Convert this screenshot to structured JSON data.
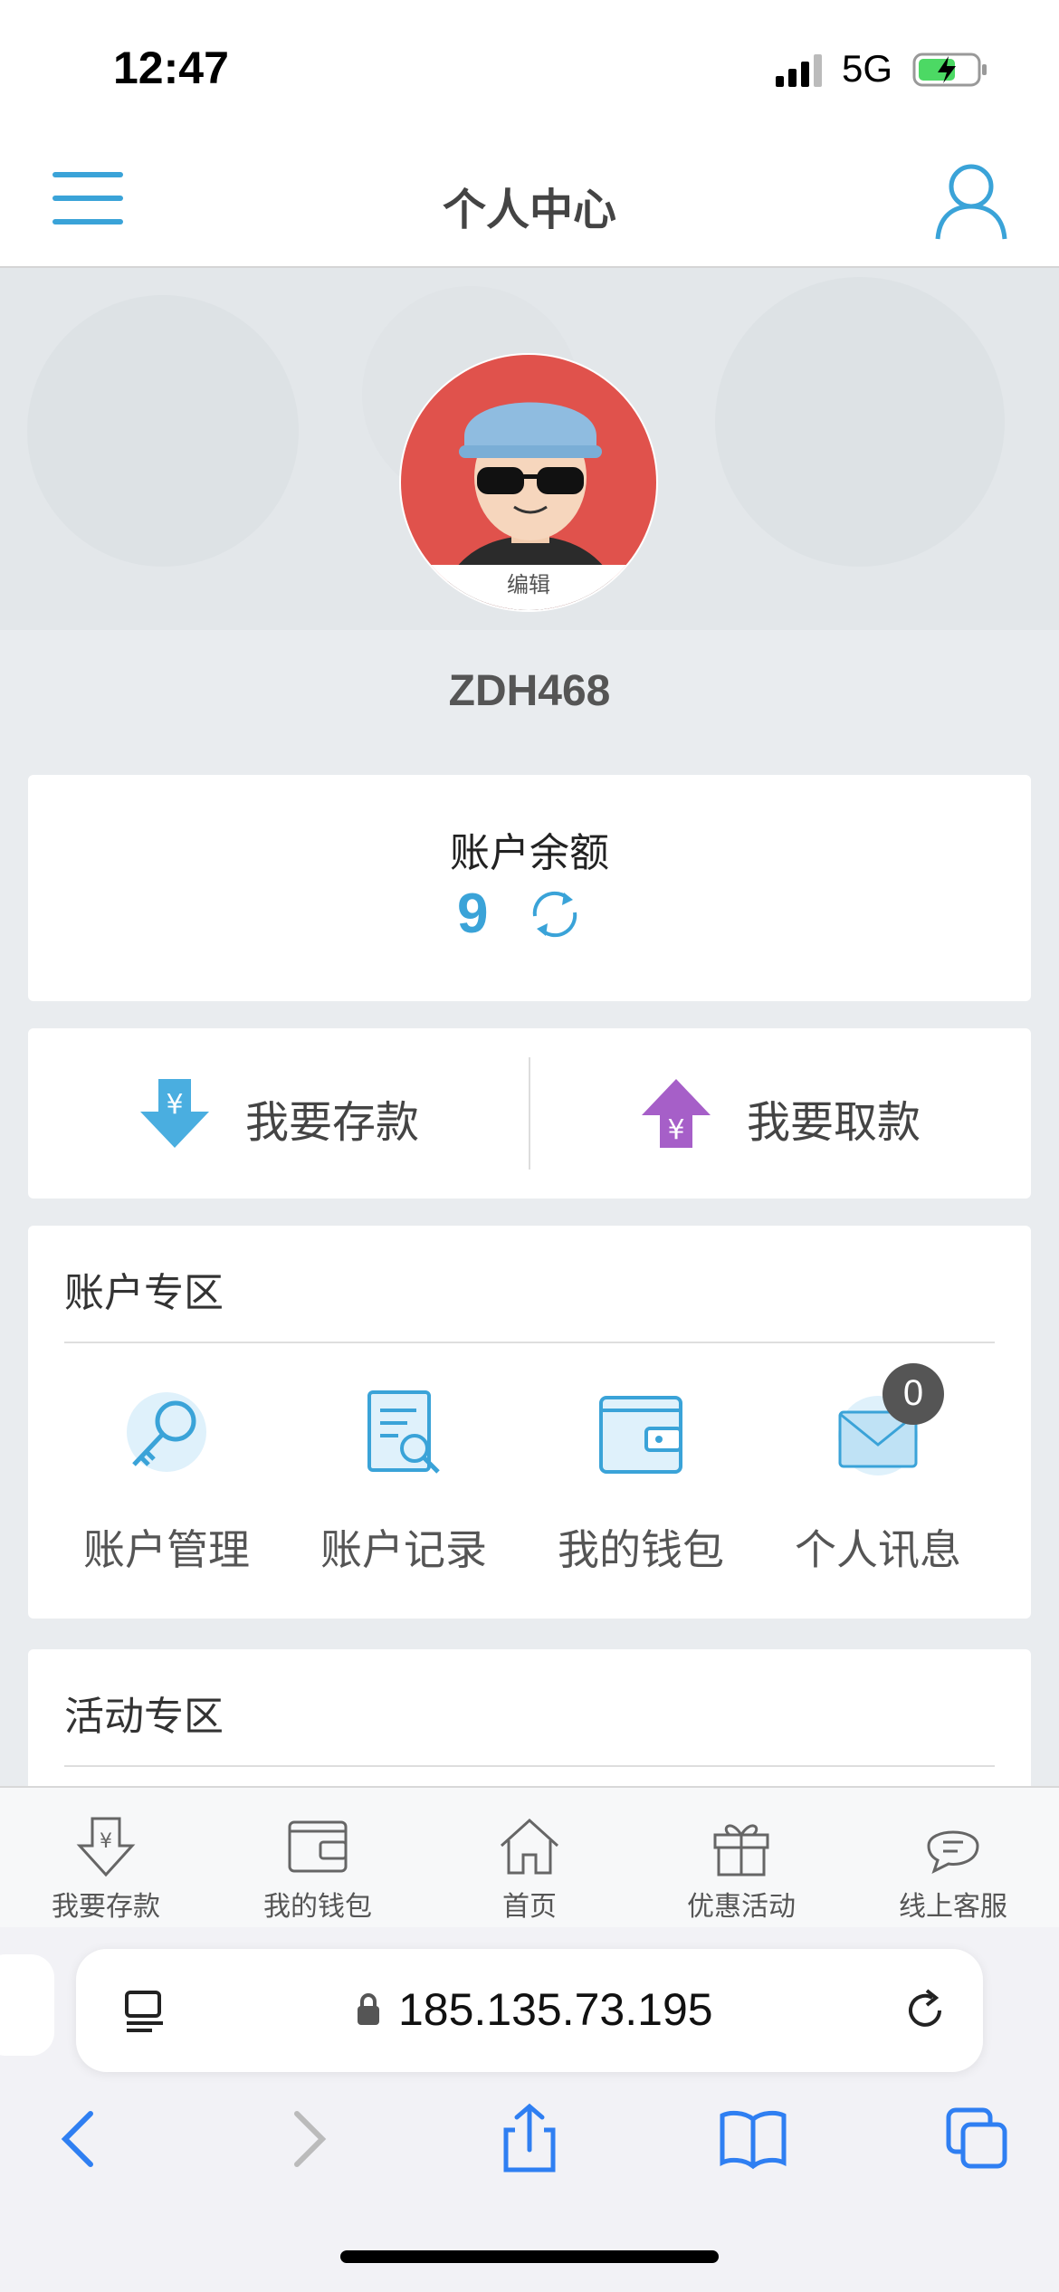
{
  "status_bar": {
    "time": "12:47",
    "network": "5G"
  },
  "header": {
    "title": "个人中心"
  },
  "profile": {
    "edit_label": "编辑",
    "username": "ZDH468"
  },
  "balance": {
    "label": "账户余额",
    "value": "9"
  },
  "actions": {
    "deposit": "我要存款",
    "withdraw": "我要取款"
  },
  "account_zone": {
    "title": "账户专区",
    "items": [
      {
        "label": "账户管理",
        "icon": "key-icon"
      },
      {
        "label": "账户记录",
        "icon": "document-search-icon"
      },
      {
        "label": "我的钱包",
        "icon": "wallet-icon"
      },
      {
        "label": "个人讯息",
        "icon": "mail-icon",
        "badge": "0"
      }
    ]
  },
  "activity_zone": {
    "title": "活动专区"
  },
  "tabbar": {
    "items": [
      {
        "label": "我要存款",
        "icon": "deposit-icon"
      },
      {
        "label": "我的钱包",
        "icon": "wallet-icon"
      },
      {
        "label": "首页",
        "icon": "home-icon"
      },
      {
        "label": "优惠活动",
        "icon": "gift-icon"
      },
      {
        "label": "线上客服",
        "icon": "chat-icon"
      }
    ]
  },
  "browser": {
    "url": "185.135.73.195"
  },
  "colors": {
    "accent": "#3aa3d8",
    "avatar_bg": "#e0524c",
    "withdraw": "#a65fc8"
  }
}
